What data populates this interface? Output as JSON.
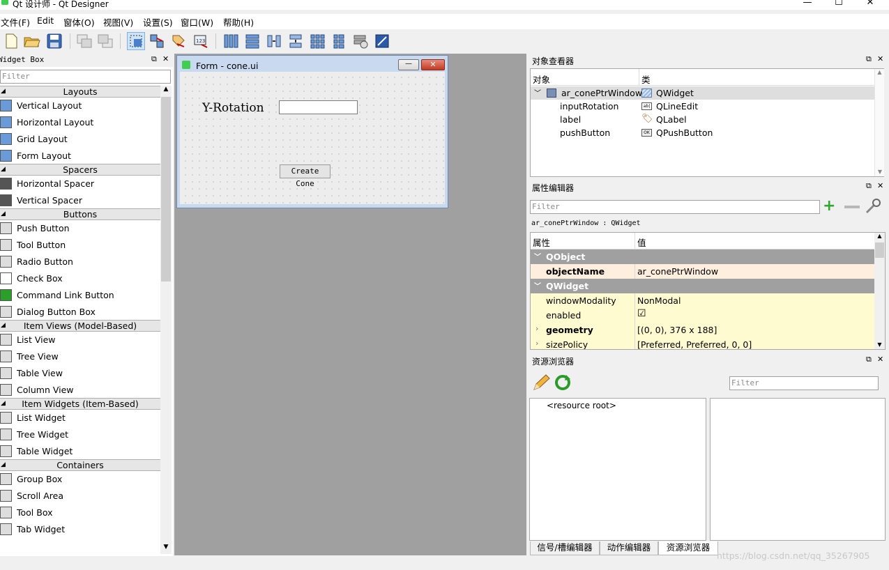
{
  "window": {
    "title": "Qt 设计师 - Qt Designer",
    "minimize": "—",
    "maximize": "☐",
    "close": "✕"
  },
  "menu": [
    "文件(F)",
    "Edit",
    "窗体(O)",
    "视图(V)",
    "设置(S)",
    "窗口(W)",
    "帮助(H)"
  ],
  "widget_box": {
    "title": "Widget Box",
    "filter_placeholder": "Filter",
    "categories": [
      {
        "name": "Layouts",
        "items": [
          "Vertical Layout",
          "Horizontal Layout",
          "Grid Layout",
          "Form Layout"
        ]
      },
      {
        "name": "Spacers",
        "items": [
          "Horizontal Spacer",
          "Vertical Spacer"
        ]
      },
      {
        "name": "Buttons",
        "items": [
          "Push Button",
          "Tool Button",
          "Radio Button",
          "Check Box",
          "Command Link Button",
          "Dialog Button Box"
        ]
      },
      {
        "name": "Item Views (Model-Based)",
        "items": [
          "List View",
          "Tree View",
          "Table View",
          "Column View"
        ]
      },
      {
        "name": "Item Widgets (Item-Based)",
        "items": [
          "List Widget",
          "Tree Widget",
          "Table Widget"
        ]
      },
      {
        "name": "Containers",
        "items": [
          "Group Box",
          "Scroll Area",
          "Tool Box",
          "Tab Widget"
        ]
      }
    ]
  },
  "form": {
    "title": "Form - cone.ui",
    "label": "Y-Rotation",
    "input_value": "",
    "button": "Create Cone"
  },
  "object_inspector": {
    "title": "对象查看器",
    "col_object": "对象",
    "col_class": "类",
    "rows": [
      {
        "name": "ar_conePtrWindow",
        "cls": "QWidget"
      },
      {
        "name": "inputRotation",
        "cls": "QLineEdit"
      },
      {
        "name": "label",
        "cls": "QLabel"
      },
      {
        "name": "pushButton",
        "cls": "QPushButton"
      }
    ]
  },
  "property_editor": {
    "title": "属性编辑器",
    "filter_placeholder": "Filter",
    "context": "ar_conePtrWindow : QWidget",
    "col_prop": "属性",
    "col_value": "值",
    "groups": [
      {
        "name": "QObject",
        "rows": [
          {
            "k": "objectName",
            "v": "ar_conePtrWindow"
          }
        ]
      },
      {
        "name": "QWidget",
        "rows": [
          {
            "k": "windowModality",
            "v": "NonModal"
          },
          {
            "k": "enabled",
            "v": "☑"
          },
          {
            "k": "geometry",
            "v": "[(0, 0), 376 x 188]"
          },
          {
            "k": "sizePolicy",
            "v": "[Preferred, Preferred, 0, 0]"
          }
        ]
      }
    ]
  },
  "resource_browser": {
    "title": "资源浏览器",
    "filter_placeholder": "Filter",
    "root": "<resource root>"
  },
  "bottom_tabs": [
    "信号/槽编辑器",
    "动作编辑器",
    "资源浏览器"
  ],
  "watermark": "https://blog.csdn.net/qq_35267905"
}
